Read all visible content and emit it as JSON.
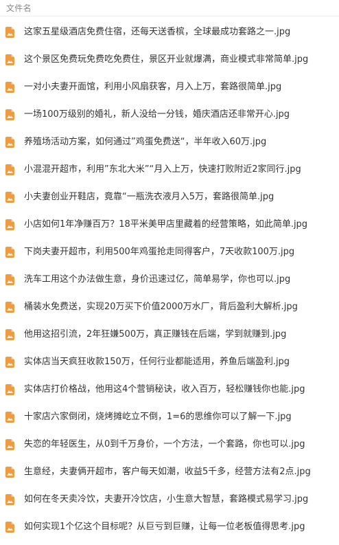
{
  "header": {
    "column_label": "文件名"
  },
  "colors": {
    "icon_accent": "#f19a44",
    "text": "#333333",
    "header_text": "#888888"
  },
  "files": [
    {
      "name": "这家五星级酒店免费住宿，还每天送香槟，全球最成功套路之一.jpg",
      "icon": "image-file-icon"
    },
    {
      "name": "这个景区免费玩免费吃免费住，景区开业就爆满，商业模式非常简单.jpg",
      "icon": "image-file-icon"
    },
    {
      "name": "一对小夫妻开面馆，利用小风扇获客，月入上万，套路很简单.jpg",
      "icon": "image-file-icon"
    },
    {
      "name": "一场100万级别的婚礼，新人没给一分钱，婚庆酒店还非常开心.jpg",
      "icon": "image-file-icon"
    },
    {
      "name": "养殖场活动方案，如何通过”鸡蛋免费送“，半年收入60万.jpg",
      "icon": "image-file-icon"
    },
    {
      "name": "小混混开超市，利用”东北大米”“月入上万，快速打败附近2家同行.jpg",
      "icon": "image-file-icon"
    },
    {
      "name": "小夫妻创业开鞋店，竟靠“一瓶洗衣液月入5万，套路很简单.jpg",
      "icon": "image-file-icon"
    },
    {
      "name": "小店如何1年净赚百万？18平米美甲店里藏着的经营策略，如此简单.jpg",
      "icon": "image-file-icon"
    },
    {
      "name": "下岗夫妻开超市，利用500年鸡蛋抢走同得客户，7天收款100万.jpg",
      "icon": "image-file-icon"
    },
    {
      "name": "洗车工用这个办法做生意，身价迅速过亿，简单易学，你也可以.jpg",
      "icon": "image-file-icon"
    },
    {
      "name": "桶装水免费送，实现20万买下价值2000万水厂，背后盈利大解析.jpg",
      "icon": "image-file-icon"
    },
    {
      "name": "他用这招引流，2年狂嫌500万，真正赚钱在后端，学到就赚到.jpg",
      "icon": "image-file-icon"
    },
    {
      "name": "实体店当天疯狂收款150万，任何行业都能适用，养鱼后端盈利.jpg",
      "icon": "image-file-icon"
    },
    {
      "name": "实体店打价格战，他用这4个营销秘诀，收入百万，轻松赚钱你也能.jpg",
      "icon": "image-file-icon"
    },
    {
      "name": "十家店六家倒闭，烧烤摊屹立不倒，1=6的思维你可以了解一下.jpg",
      "icon": "image-file-icon"
    },
    {
      "name": "失恋的年轻医生，从0到千万身价，一个方法，一个套路，你也可以.jpg",
      "icon": "image-file-icon"
    },
    {
      "name": "生意经，夫妻俩开超市，客户每天如潮，收益5千多，经营方法有2点.jpg",
      "icon": "image-file-icon"
    },
    {
      "name": "如何在冬天卖冷饮，夫妻开冷饮店，小生意大智慧，套路模式易学习.jpg",
      "icon": "image-file-icon"
    },
    {
      "name": "如何实现1个亿这个目标呢？从巨亏到巨赚，让每一位老板值得思考.jpg",
      "icon": "image-file-icon"
    }
  ]
}
